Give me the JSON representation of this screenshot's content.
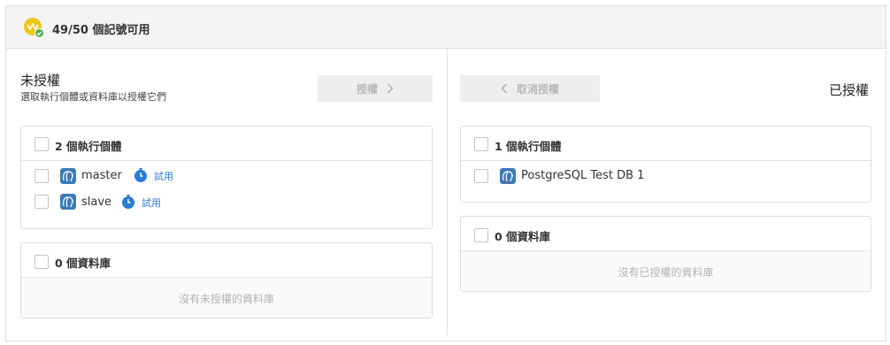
{
  "header": {
    "quota_text": "49/50 個記號可用"
  },
  "left": {
    "title": "未授權",
    "subtitle": "選取執行個體或資料庫以授權它們",
    "authorize_button": "授權",
    "instances_panel": {
      "header": "2 個執行個體",
      "rows": [
        {
          "name": "master",
          "trial": "試用"
        },
        {
          "name": "slave",
          "trial": "試用"
        }
      ]
    },
    "databases_panel": {
      "header": "0 個資料庫",
      "empty": "沒有未授權的資料庫"
    }
  },
  "right": {
    "title": "已授權",
    "unauthorize_button": "取消授權",
    "instances_panel": {
      "header": "1 個執行個體",
      "rows": [
        {
          "name": "PostgreSQL Test DB 1"
        }
      ]
    },
    "databases_panel": {
      "header": "0 個資料庫",
      "empty": "沒有已授權的資料庫"
    }
  },
  "icons": {
    "badge": "token-coin-icon",
    "instance": "postgresql-elephant-icon",
    "trial": "stopwatch-icon",
    "authorize": "chevron-right-icon",
    "unauthorize": "chevron-left-icon"
  },
  "colors": {
    "accent": "#2b7cd3",
    "badge": "#f0c419",
    "check": "#4caf50",
    "pg": "#3d7ab7"
  }
}
